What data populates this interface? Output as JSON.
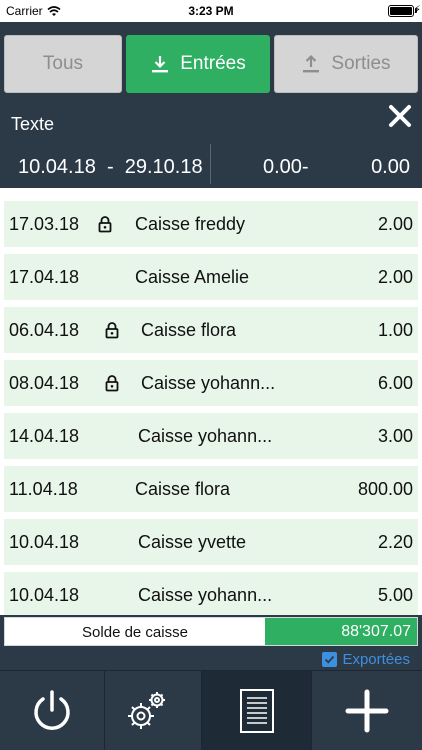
{
  "status_bar": {
    "carrier": "Carrier",
    "time": "3:23 PM"
  },
  "segments": [
    {
      "label": "Tous",
      "icon": "none",
      "selected": false
    },
    {
      "label": "Entrées",
      "icon": "download-icon",
      "selected": true
    },
    {
      "label": "Sorties",
      "icon": "upload-icon",
      "selected": false
    }
  ],
  "filter": {
    "text_label": "Texte",
    "date_range": "10.04.18  -  29.10.18",
    "amount_from": "0.00-",
    "amount_to": "0.00"
  },
  "entries": [
    {
      "date": "17.03.18",
      "locked": true,
      "name": "Caisse freddy",
      "amount": "2.00"
    },
    {
      "date": "17.04.18",
      "locked": false,
      "name": "Caisse Amelie",
      "amount": "2.00"
    },
    {
      "date": "06.04.18",
      "locked": true,
      "name": "Caisse flora",
      "amount": "1.00"
    },
    {
      "date": "08.04.18",
      "locked": true,
      "name": "Caisse yohann...",
      "amount": "6.00"
    },
    {
      "date": "14.04.18",
      "locked": false,
      "name": "Caisse yohann...",
      "amount": "3.00"
    },
    {
      "date": "11.04.18",
      "locked": false,
      "name": "Caisse flora",
      "amount": "800.00"
    },
    {
      "date": "10.04.18",
      "locked": false,
      "name": "Caisse yvette",
      "amount": "2.20"
    },
    {
      "date": "10.04.18",
      "locked": false,
      "name": "Caisse yohann...",
      "amount": "5.00"
    }
  ],
  "balance": {
    "label": "Solde de caisse",
    "value": "88'307.07"
  },
  "exported": {
    "label": "Exportées",
    "checked": true
  },
  "tabs": [
    {
      "icon": "power-icon"
    },
    {
      "icon": "settings-gears-icon"
    },
    {
      "icon": "document-list-icon",
      "active": true
    },
    {
      "icon": "add-icon"
    }
  ],
  "colors": {
    "accent_green": "#2eaf62",
    "nav_dark": "#2c3a48",
    "row_bg": "#e8f5e9",
    "link_blue": "#3d8fe0"
  }
}
